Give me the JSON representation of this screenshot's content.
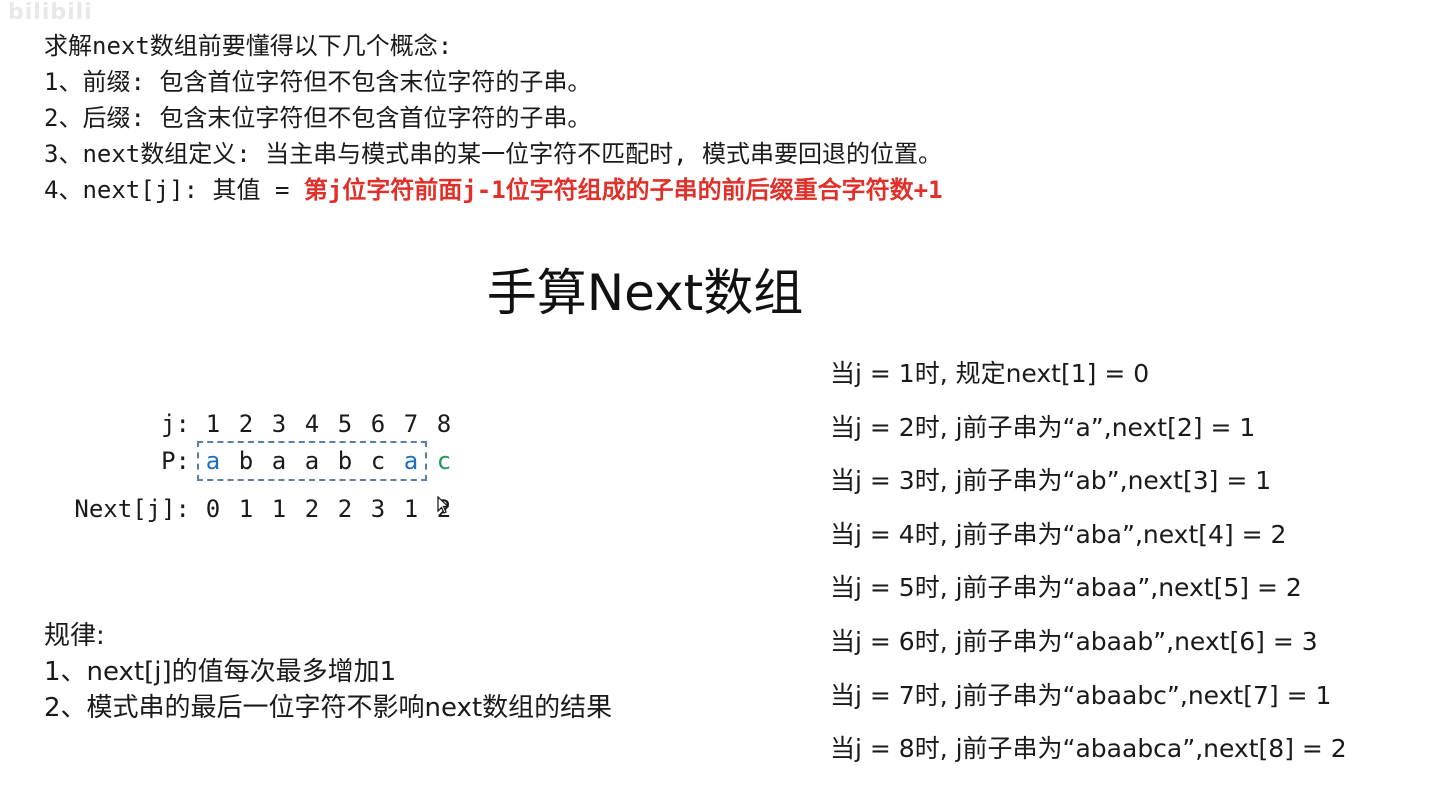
{
  "watermark": "bilibili",
  "concepts": {
    "intro": "求解next数组前要懂得以下几个概念:",
    "line1": "1、前缀: 包含首位字符但不包含末位字符的子串。",
    "line2": "2、后缀: 包含末位字符但不包含首位字符的子串。",
    "line3": "3、next数组定义: 当主串与模式串的某一位字符不匹配时, 模式串要回退的位置。",
    "line4_prefix": "4、next[j]: 其值 = ",
    "line4_highlight": "第j位字符前面j-1位字符组成的子串的前后缀重合字符数+1"
  },
  "title": "手算Next数组",
  "table": {
    "j_label": "j:",
    "p_label": "P:",
    "next_label": "Next[j]:",
    "j_values": [
      "1",
      "2",
      "3",
      "4",
      "5",
      "6",
      "7",
      "8"
    ],
    "p_values": [
      "a",
      "b",
      "a",
      "a",
      "b",
      "c",
      "a",
      "c"
    ],
    "next_values": [
      "0",
      "1",
      "1",
      "2",
      "2",
      "3",
      "1",
      "2"
    ]
  },
  "rules": {
    "heading": "规律:",
    "rule1": "1、next[j]的值每次最多增加1",
    "rule2": "2、模式串的最后一位字符不影响next数组的结果"
  },
  "steps": [
    "当j = 1时, 规定next[1] = 0",
    "当j = 2时, j前子串为“a”,next[2] = 1",
    "当j = 3时, j前子串为“ab”,next[3] = 1",
    "当j = 4时, j前子串为“aba”,next[4] = 2",
    "当j = 5时, j前子串为“abaa”,next[5] = 2",
    "当j = 6时, j前子串为“abaab”,next[6] = 3",
    "当j = 7时, j前子串为“abaabc”,next[7] = 1",
    "当j = 8时, j前子串为“abaabca”,next[8] = 2"
  ],
  "colors": {
    "highlight_red": "#e0302a",
    "match_blue": "#1f6fc0",
    "mismatch_green": "#1f9a5a"
  }
}
